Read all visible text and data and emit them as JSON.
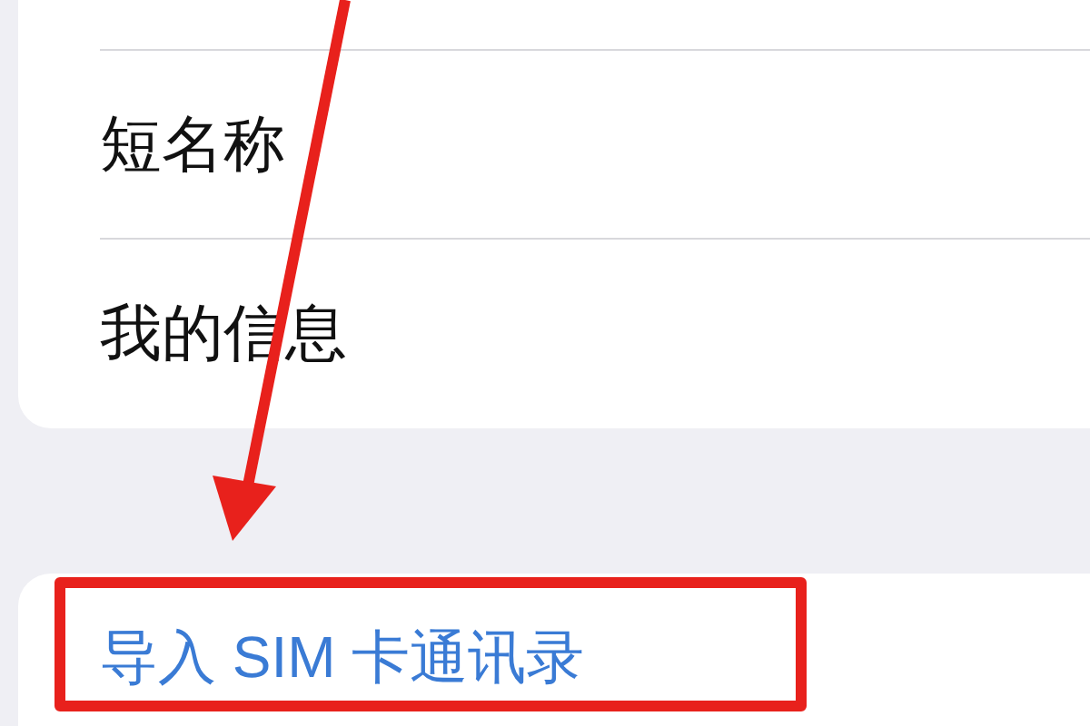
{
  "contact_settings": {
    "rows": [
      {
        "label": "短名称"
      },
      {
        "label": "我的信息"
      }
    ]
  },
  "import_section": {
    "action": "导入 SIM 卡通讯录"
  }
}
